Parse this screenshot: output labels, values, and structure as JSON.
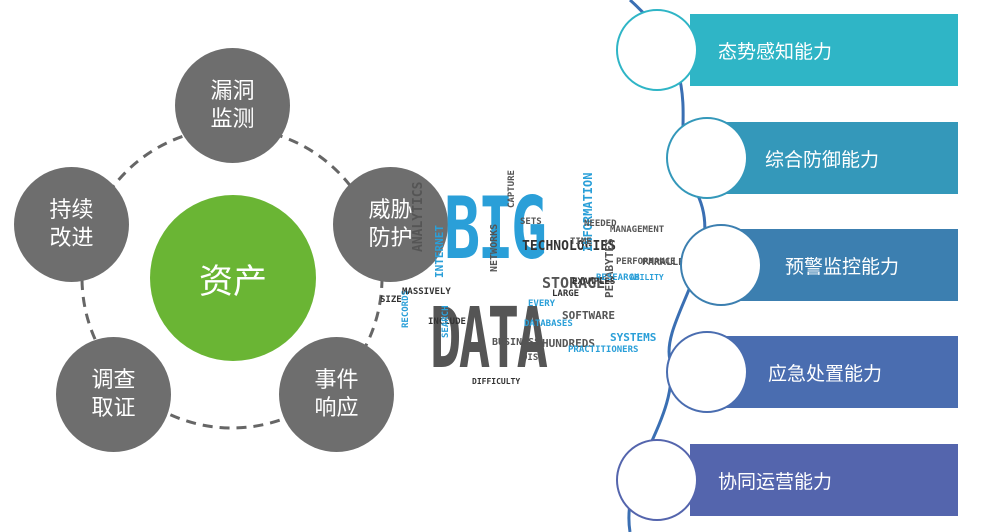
{
  "cycle": {
    "center": "资产",
    "nodes": [
      {
        "id": "vuln",
        "label": "漏洞\n监测"
      },
      {
        "id": "threat",
        "label": "威胁\n防护"
      },
      {
        "id": "incident",
        "label": "事件\n响应"
      },
      {
        "id": "forensics",
        "label": "调查\n取证"
      },
      {
        "id": "improve",
        "label": "持续\n改进"
      }
    ]
  },
  "word_cloud": {
    "big": "BIG",
    "data": "DATA",
    "words": [
      "TECHNOLOGIES",
      "STORAGE",
      "ANALYTICS",
      "INTERNET",
      "INFORMATION",
      "DATABASES",
      "NETWORKS",
      "PETABYTES",
      "SYSTEMS",
      "SOFTWARE",
      "RESEARCH",
      "INCLUDE",
      "SIZE",
      "SETS",
      "HUNDREDS",
      "EXAMPLES",
      "PARALLEL",
      "LARGE",
      "MANAGEMENT",
      "ABILITY",
      "PERFORMANCE",
      "CAPTURE",
      "DISK",
      "SEARCH",
      "RECORDS",
      "TIME",
      "NEEDED",
      "EVERY",
      "BUSINESS",
      "MASSIVELY",
      "PRACTITIONERS",
      "DIFFICULTY"
    ]
  },
  "capabilities": [
    {
      "label": "态势感知能力",
      "color": "#2fb5c6"
    },
    {
      "label": "综合防御能力",
      "color": "#3498ba"
    },
    {
      "label": "预警监控能力",
      "color": "#3c7fb0"
    },
    {
      "label": "应急处置能力",
      "color": "#4a6db0"
    },
    {
      "label": "协同运营能力",
      "color": "#5465ad"
    }
  ]
}
